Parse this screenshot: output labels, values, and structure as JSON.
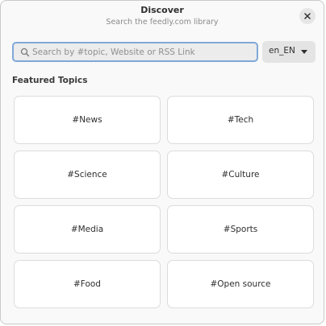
{
  "header": {
    "title": "Discover",
    "subtitle": "Search the feedly.com library",
    "close_icon": "close-icon"
  },
  "search": {
    "placeholder": "Search by #topic, Website or RSS Link",
    "value": "",
    "icon": "search-icon"
  },
  "language": {
    "selected": "en_EN",
    "icon": "chevron-down-icon"
  },
  "featured": {
    "heading": "Featured Topics",
    "topics": [
      {
        "label": "#News"
      },
      {
        "label": "#Tech"
      },
      {
        "label": "#Science"
      },
      {
        "label": "#Culture"
      },
      {
        "label": "#Media"
      },
      {
        "label": "#Sports"
      },
      {
        "label": "#Food"
      },
      {
        "label": "#Open source"
      }
    ]
  }
}
